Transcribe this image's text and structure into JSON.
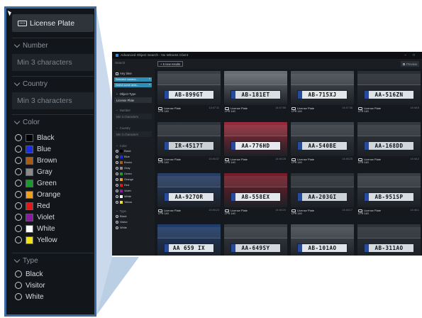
{
  "zoom": {
    "selected_type": "License Plate",
    "number_header": "Number",
    "number_placeholder": "Min 3 characters",
    "country_header": "Country",
    "country_placeholder": "Min 3 characters",
    "color_header": "Color",
    "colors": [
      {
        "label": "Black",
        "swatch": "#000000"
      },
      {
        "label": "Blue",
        "swatch": "#1b2fe0"
      },
      {
        "label": "Brown",
        "swatch": "#a85b12"
      },
      {
        "label": "Gray",
        "swatch": "#8a8a8a"
      },
      {
        "label": "Green",
        "swatch": "#1a9a2a"
      },
      {
        "label": "Orange",
        "swatch": "#f0a020"
      },
      {
        "label": "Red",
        "swatch": "#e01818"
      },
      {
        "label": "Violet",
        "swatch": "#8a1aa0"
      },
      {
        "label": "White",
        "swatch": "#ffffff"
      },
      {
        "label": "Yellow",
        "swatch": "#f2e21a"
      }
    ],
    "type_header": "Type",
    "types": [
      "Black",
      "Visitor",
      "White"
    ]
  },
  "window": {
    "title": "Advanced Object Search - Nx Witness Client",
    "search_placeholder": "Search",
    "new_results": "+ 5 new results",
    "preview_label": "Preview",
    "minimize": "–",
    "maximize": "□",
    "sidebar": {
      "any_time": "Any time",
      "selected_camera": "Selected camera...",
      "select_area": "Select some area...",
      "object_type_header": "Object Type",
      "selected_type": "License Plate",
      "number_header": "Number",
      "number_placeholder": "Min 3 characters",
      "country_header": "Country",
      "country_placeholder": "Min 3 characters",
      "color_header": "Color",
      "colors": [
        {
          "label": "Black",
          "swatch": "#000000"
        },
        {
          "label": "Blue",
          "swatch": "#1b2fe0"
        },
        {
          "label": "Brown",
          "swatch": "#a85b12"
        },
        {
          "label": "Gray",
          "swatch": "#8a8a8a"
        },
        {
          "label": "Green",
          "swatch": "#1a9a2a"
        },
        {
          "label": "Orange",
          "swatch": "#f0a020"
        },
        {
          "label": "Red",
          "swatch": "#e01818"
        },
        {
          "label": "Violet",
          "swatch": "#8a1aa0"
        },
        {
          "label": "White",
          "swatch": "#ffffff"
        },
        {
          "label": "Yellow",
          "swatch": "#f2e21a"
        }
      ],
      "type_header": "Type",
      "types": [
        "Black",
        "Visitor",
        "White"
      ]
    },
    "results": [
      {
        "plate": "AB-899GT",
        "label": "License Plate",
        "sub": "LPR 140",
        "time": "14:47:11",
        "bg": "#3a4047",
        "plate_bg": "#dfe5ea"
      },
      {
        "plate": "AB-181ET",
        "label": "License Plate",
        "sub": "LPR 140",
        "time": "14:47:55",
        "bg": "#6b7077",
        "plate_bg": "#d9dee2"
      },
      {
        "plate": "AB-715XJ",
        "label": "License Plate",
        "sub": "LPR 140",
        "time": "14:47:36",
        "bg": "#4d5258",
        "plate_bg": "#e3e7ea"
      },
      {
        "plate": "AA-516ZN",
        "label": "License Plate",
        "sub": "LPR 140",
        "time": "14:46:5",
        "bg": "#2a2f35",
        "plate_bg": "#dde3e8"
      },
      {
        "plate": "IR-4517T",
        "label": "License Plate",
        "sub": "LPR 140",
        "time": "14:46:37",
        "bg": "#2f353c",
        "plate_bg": "#c9d0d6"
      },
      {
        "plate": "AA-776HD",
        "label": "License Plate",
        "sub": "LPR 140",
        "time": "14:46:28",
        "bg": "#9a2a3a",
        "plate_bg": "#e6eaee"
      },
      {
        "plate": "AA-540BE",
        "label": "License Plate",
        "sub": "LPR 140",
        "time": "14:46:25",
        "bg": "#3d434a",
        "plate_bg": "#d5dbe0"
      },
      {
        "plate": "AA-168DD",
        "label": "License Plate",
        "sub": "LPR 140",
        "time": "14:46:2",
        "bg": "#343a40",
        "plate_bg": "#cfd6dc"
      },
      {
        "plate": "AA-927OR",
        "label": "License Plate",
        "sub": "LPR 140",
        "time": "14:46:23",
        "bg": "#26406a",
        "plate_bg": "#dfe5ea"
      },
      {
        "plate": "AB-558EX",
        "label": "License Plate",
        "sub": "LPR 140",
        "time": "14:46:20",
        "bg": "#7a1d2a",
        "plate_bg": "#e3e8ec"
      },
      {
        "plate": "AA-203GI",
        "label": "License Plate",
        "sub": "LPR 140",
        "time": "14:46:17",
        "bg": "#2d3238",
        "plate_bg": "#cbd2d8"
      },
      {
        "plate": "AB-951SP",
        "label": "License Plate",
        "sub": "LPR 140",
        "time": "14:46:1",
        "bg": "#383e45",
        "plate_bg": "#d7dde2"
      },
      {
        "plate": "AA 659 IX",
        "label": "",
        "sub": "",
        "time": "",
        "bg": "#1f3e70",
        "plate_bg": "#dfe5ea"
      },
      {
        "plate": "AA-649SY",
        "label": "",
        "sub": "",
        "time": "",
        "bg": "#3a3f46",
        "plate_bg": "#d2d8de"
      },
      {
        "plate": "AB-101AO",
        "label": "",
        "sub": "",
        "time": "",
        "bg": "#4a5057",
        "plate_bg": "#dfe5ea"
      },
      {
        "plate": "AB-311AO",
        "label": "",
        "sub": "",
        "time": "",
        "bg": "#2e343a",
        "plate_bg": "#d5dbe0"
      }
    ]
  }
}
